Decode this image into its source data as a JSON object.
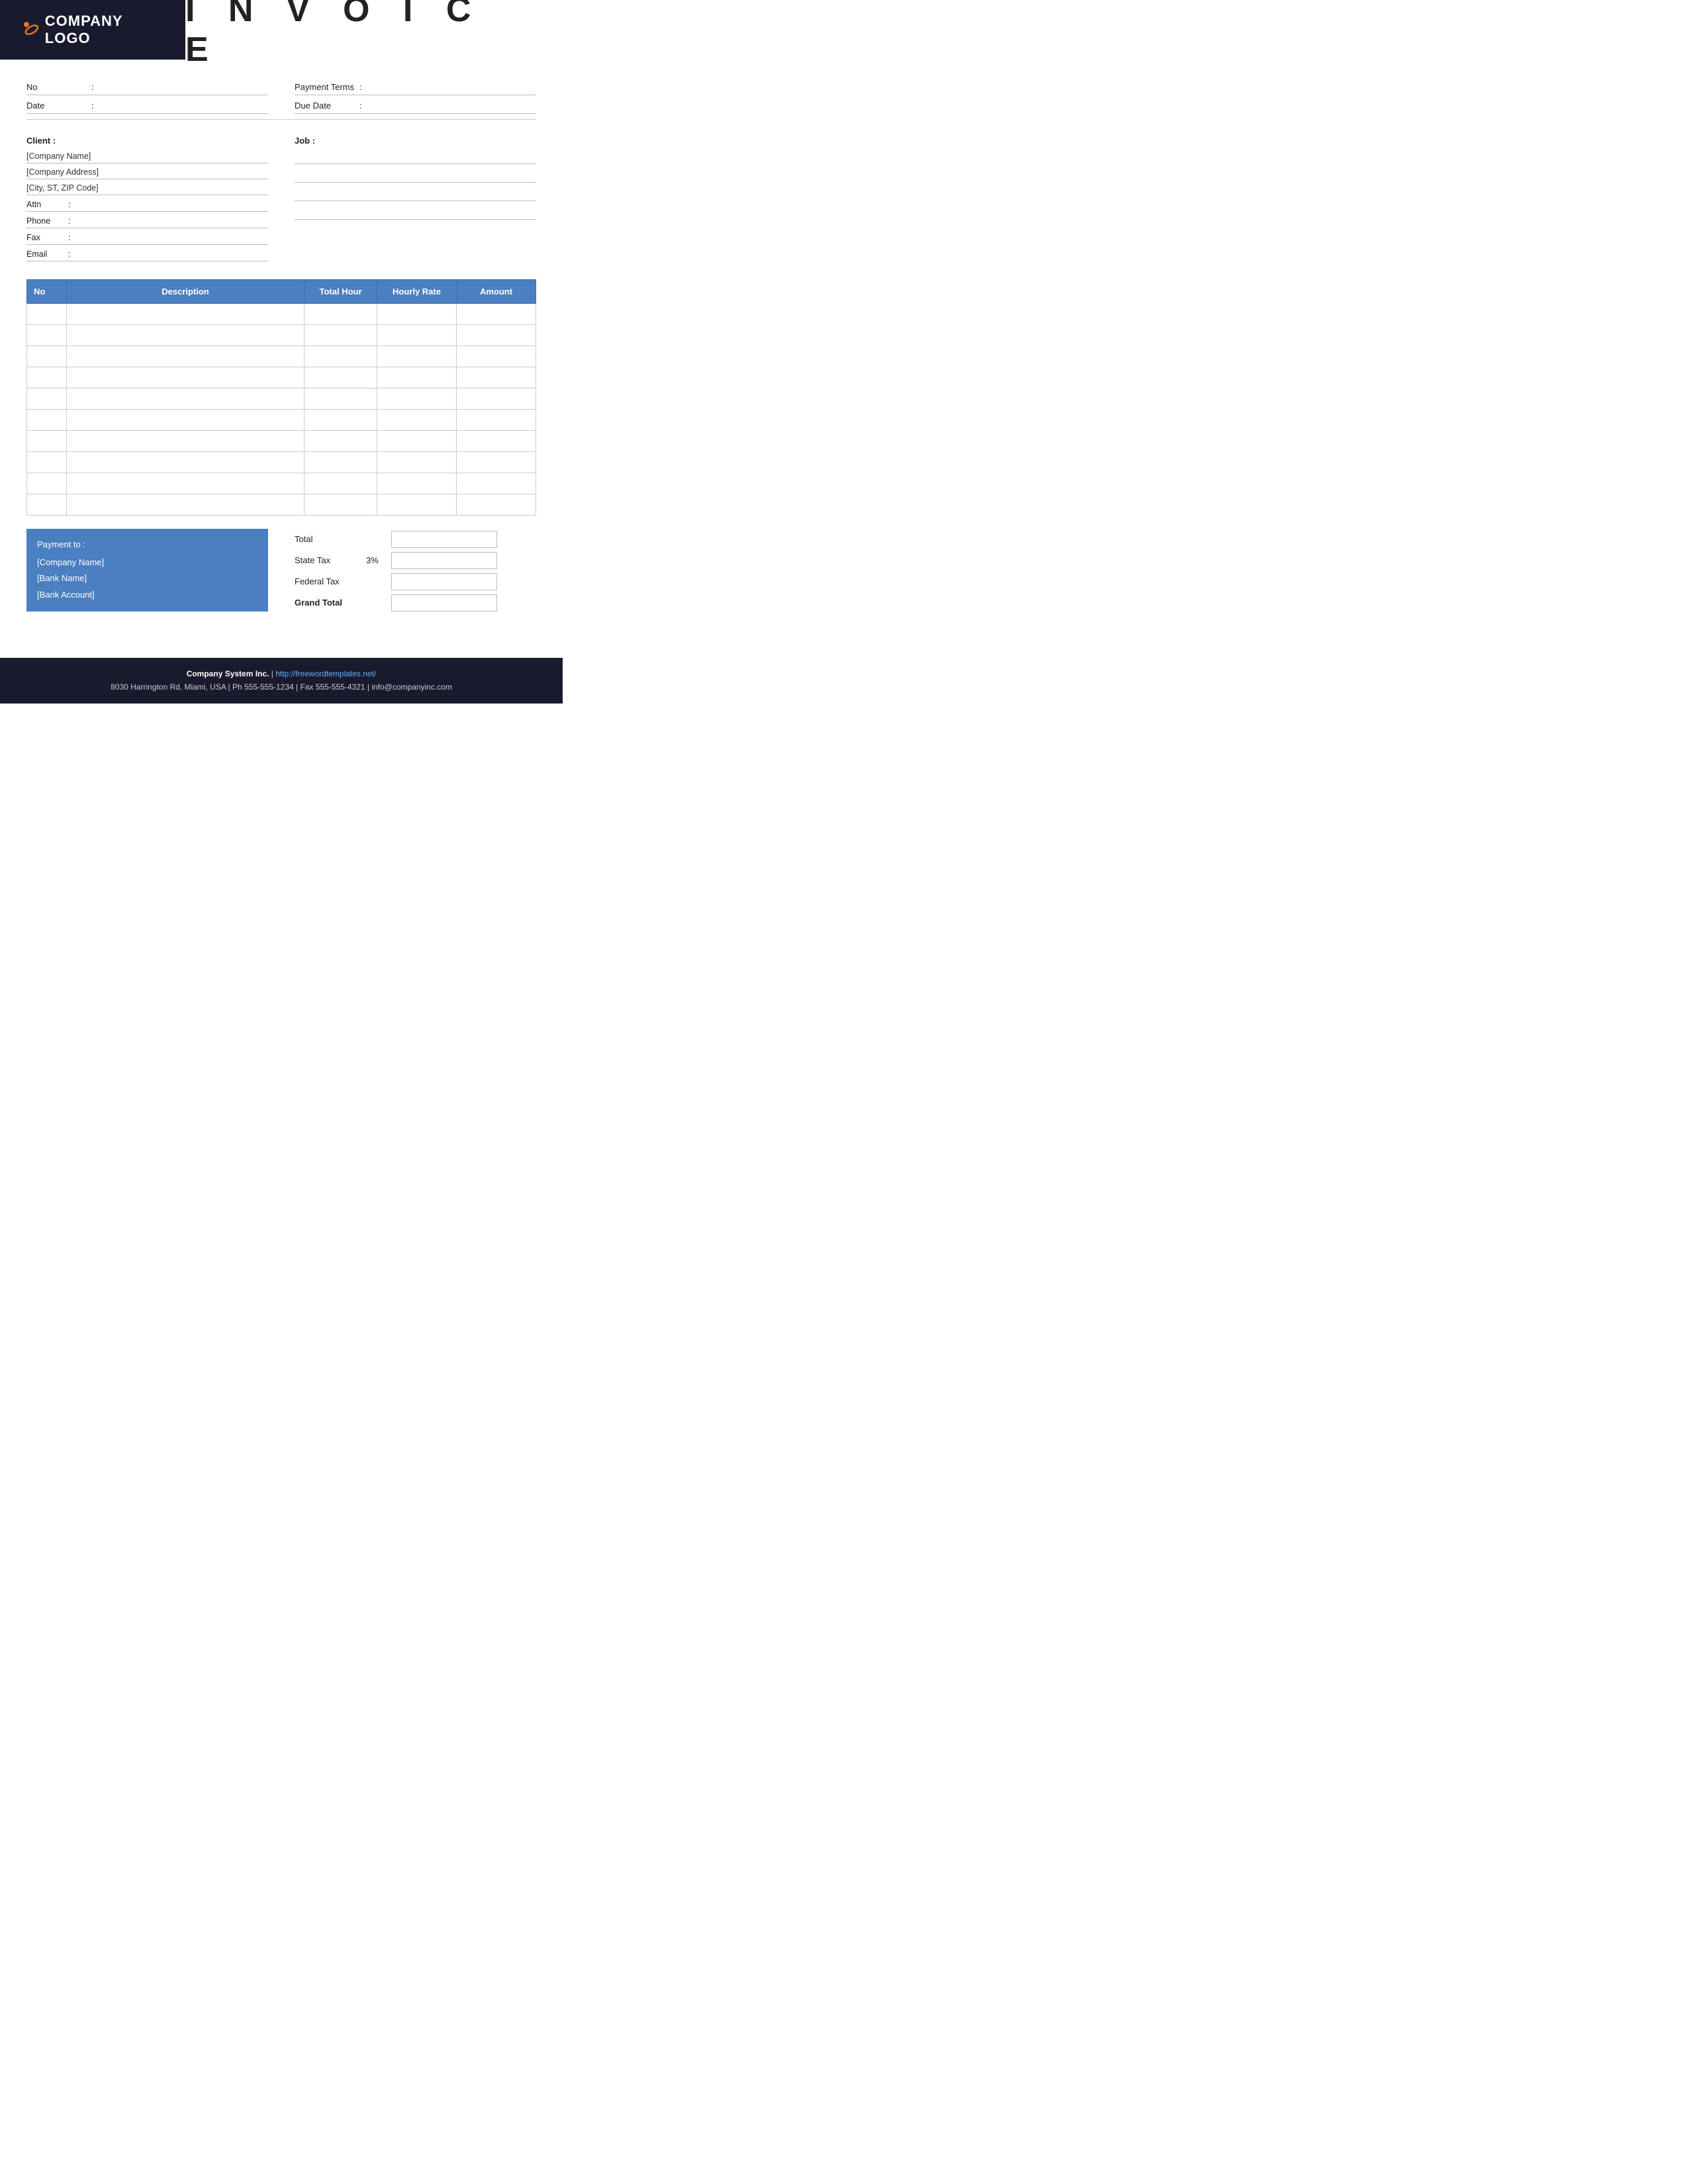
{
  "header": {
    "logo_text": "COMPANY LOGO",
    "invoice_title": "I N V O I C E"
  },
  "top_fields": {
    "left": [
      {
        "label": "No",
        "colon": ":",
        "value": ""
      },
      {
        "label": "Date",
        "colon": ":",
        "value": ""
      }
    ],
    "right": [
      {
        "label": "Payment  Terms",
        "colon": ":",
        "value": ""
      },
      {
        "label": "Due Date",
        "colon": ":",
        "value": ""
      }
    ]
  },
  "client": {
    "label": "Client :",
    "company_name": "[Company Name]",
    "company_address": "[Company Address]",
    "city": "[City, ST, ZIP Code]",
    "attn_label": "Attn",
    "attn_colon": ":",
    "phone_label": "Phone",
    "phone_colon": ":",
    "fax_label": "Fax",
    "fax_colon": ":",
    "email_label": "Email",
    "email_colon": ":"
  },
  "job": {
    "label": "Job  :",
    "lines": [
      "",
      "",
      "",
      ""
    ]
  },
  "table": {
    "headers": [
      "No",
      "Description",
      "Total Hour",
      "Hourly Rate",
      "Amount"
    ],
    "empty_rows": 10
  },
  "payment": {
    "to_label": "Payment to :",
    "company_name": "[Company Name]",
    "bank_name": "[Bank Name]",
    "bank_account": "[Bank Account]"
  },
  "totals": {
    "total_label": "Total",
    "state_tax_label": "State Tax",
    "state_tax_pct": "3%",
    "federal_tax_label": "Federal Tax",
    "grand_total_label": "Grand Total"
  },
  "footer": {
    "company": "Company System Inc.",
    "separator": "|",
    "website": "http://freewordtemplates.net/",
    "address": "8030 Harrington Rd, Miami, USA | Ph 555-555-1234 | Fax 555-555-4321 | info@companyinc.com"
  }
}
